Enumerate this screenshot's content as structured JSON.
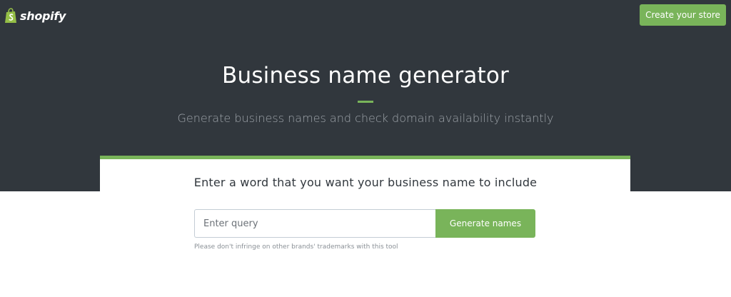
{
  "header": {
    "logo_text": "shopify",
    "logo_icon": "shopify-bag-icon",
    "cta_label": "Create your store"
  },
  "hero": {
    "title": "Business name generator",
    "subtitle": "Generate business names and check domain availability instantly"
  },
  "form": {
    "heading": "Enter a word that you want your business name to include",
    "query_placeholder": "Enter query",
    "query_value": "",
    "submit_label": "Generate names",
    "disclaimer": "Please don't infringe on other brands' trademarks with this tool"
  },
  "colors": {
    "hero_bg": "#31373d",
    "accent": "#79b45a",
    "page_bg": "#ffffff"
  }
}
